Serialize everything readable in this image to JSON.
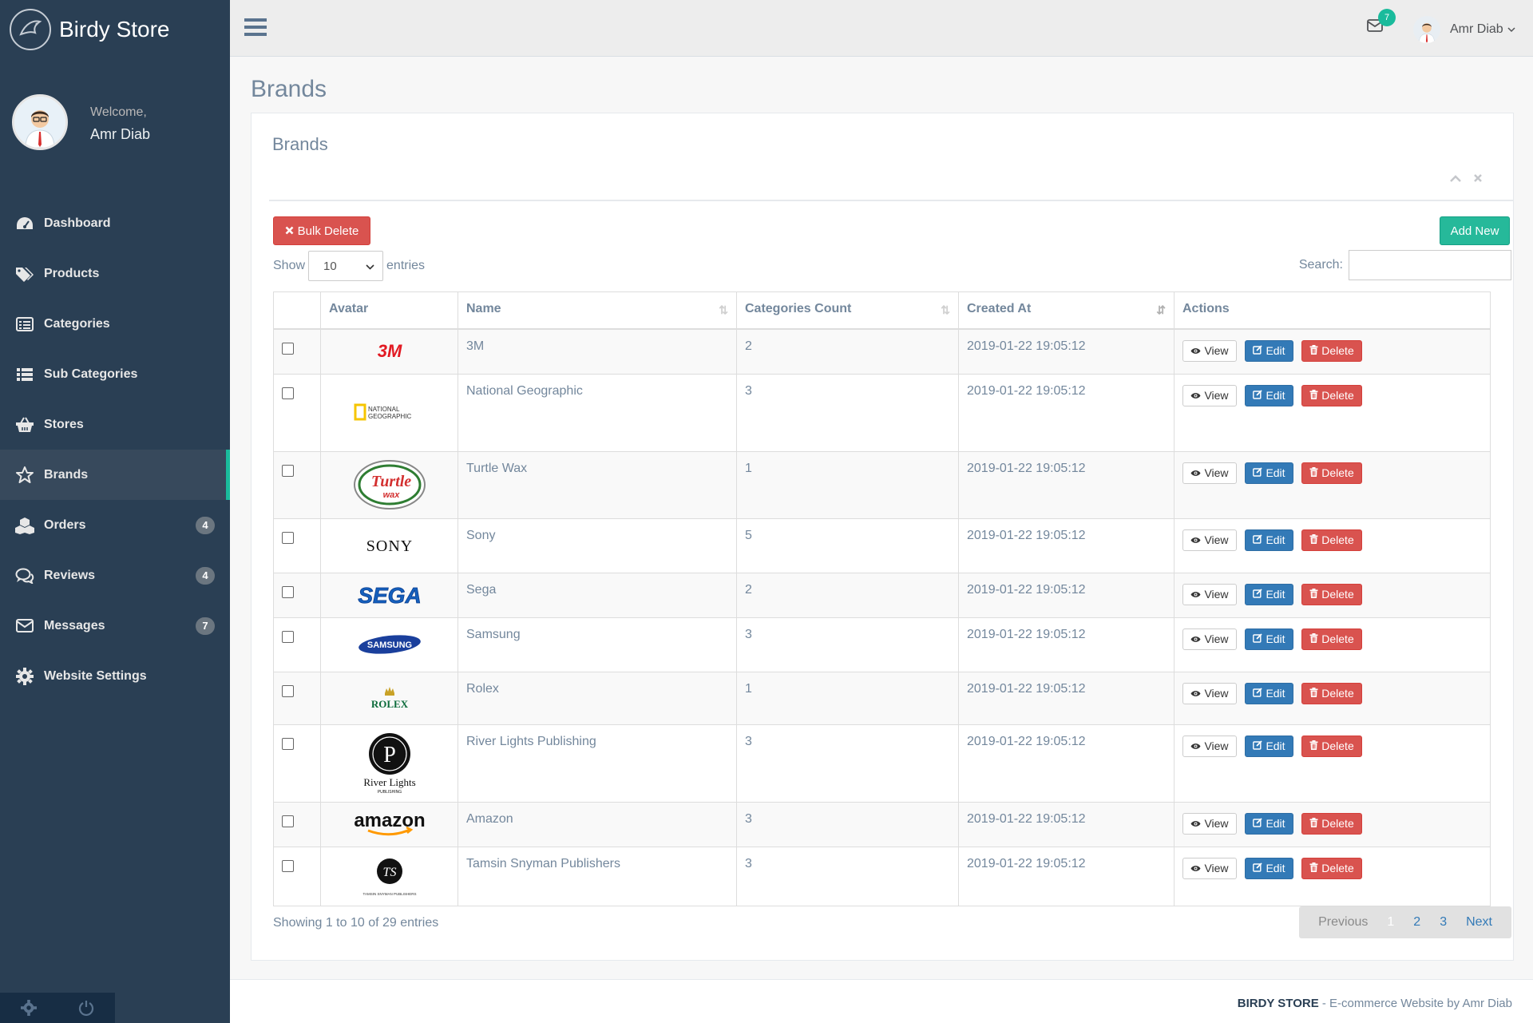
{
  "app": {
    "brand_name": "Birdy Store",
    "welcome": "Welcome,",
    "user_name": "Amr Diab"
  },
  "sidebar": {
    "items": [
      {
        "label": "Dashboard",
        "icon": "dashboard-icon"
      },
      {
        "label": "Products",
        "icon": "tags-icon"
      },
      {
        "label": "Categories",
        "icon": "list-alt-icon"
      },
      {
        "label": "Sub Categories",
        "icon": "list-icon"
      },
      {
        "label": "Stores",
        "icon": "basket-icon"
      },
      {
        "label": "Brands",
        "icon": "star-icon",
        "active": true
      },
      {
        "label": "Orders",
        "icon": "cubes-icon",
        "badge": "4"
      },
      {
        "label": "Reviews",
        "icon": "comments-icon",
        "badge": "4"
      },
      {
        "label": "Messages",
        "icon": "envelope-icon",
        "badge": "7"
      },
      {
        "label": "Website Settings",
        "icon": "gear-icon"
      }
    ]
  },
  "topbar": {
    "mail_count": "7",
    "user_name": "Amr Diab"
  },
  "page": {
    "title": "Brands",
    "panel_title": "Brands",
    "bulk_delete": "Bulk Delete",
    "add_new": "Add New",
    "show_label": "Show",
    "page_size": "10",
    "entries_label": "entries",
    "search_label": "Search:"
  },
  "table": {
    "columns": [
      "Avatar",
      "Name",
      "Categories Count",
      "Created At",
      "Actions"
    ],
    "rows": [
      {
        "name": "3M",
        "count": "2",
        "created": "2019-01-22 19:05:12",
        "logo": "3M"
      },
      {
        "name": "National Geographic",
        "count": "3",
        "created": "2019-01-22 19:05:12",
        "logo": "NATIONAL GEOGRAPHIC"
      },
      {
        "name": "Turtle Wax",
        "count": "1",
        "created": "2019-01-22 19:05:12",
        "logo": "Turtle wax"
      },
      {
        "name": "Sony",
        "count": "5",
        "created": "2019-01-22 19:05:12",
        "logo": "SONY"
      },
      {
        "name": "Sega",
        "count": "2",
        "created": "2019-01-22 19:05:12",
        "logo": "SEGA"
      },
      {
        "name": "Samsung",
        "count": "3",
        "created": "2019-01-22 19:05:12",
        "logo": "SAMSUNG"
      },
      {
        "name": "Rolex",
        "count": "1",
        "created": "2019-01-22 19:05:12",
        "logo": "ROLEX"
      },
      {
        "name": "River Lights Publishing",
        "count": "3",
        "created": "2019-01-22 19:05:12",
        "logo": "River Lights PUBLISHING"
      },
      {
        "name": "Amazon",
        "count": "3",
        "created": "2019-01-22 19:05:12",
        "logo": "amazon"
      },
      {
        "name": "Tamsin Snyman Publishers",
        "count": "3",
        "created": "2019-01-22 19:05:12",
        "logo": "TAMSIN SNYMAN PUBLISHERS"
      }
    ],
    "actions": {
      "view": "View",
      "edit": "Edit",
      "delete": "Delete"
    }
  },
  "pagination": {
    "info": "Showing 1 to 10 of 29 entries",
    "previous": "Previous",
    "pages": [
      "1",
      "2",
      "3"
    ],
    "next": "Next"
  },
  "footer": {
    "brand": "BIRDY STORE",
    "text": " - E-commerce Website by Amr Diab"
  },
  "colors": {
    "sidebar": "#2a3f54",
    "accent": "#1abb9c",
    "danger": "#d9534f",
    "primary": "#337ab7"
  }
}
